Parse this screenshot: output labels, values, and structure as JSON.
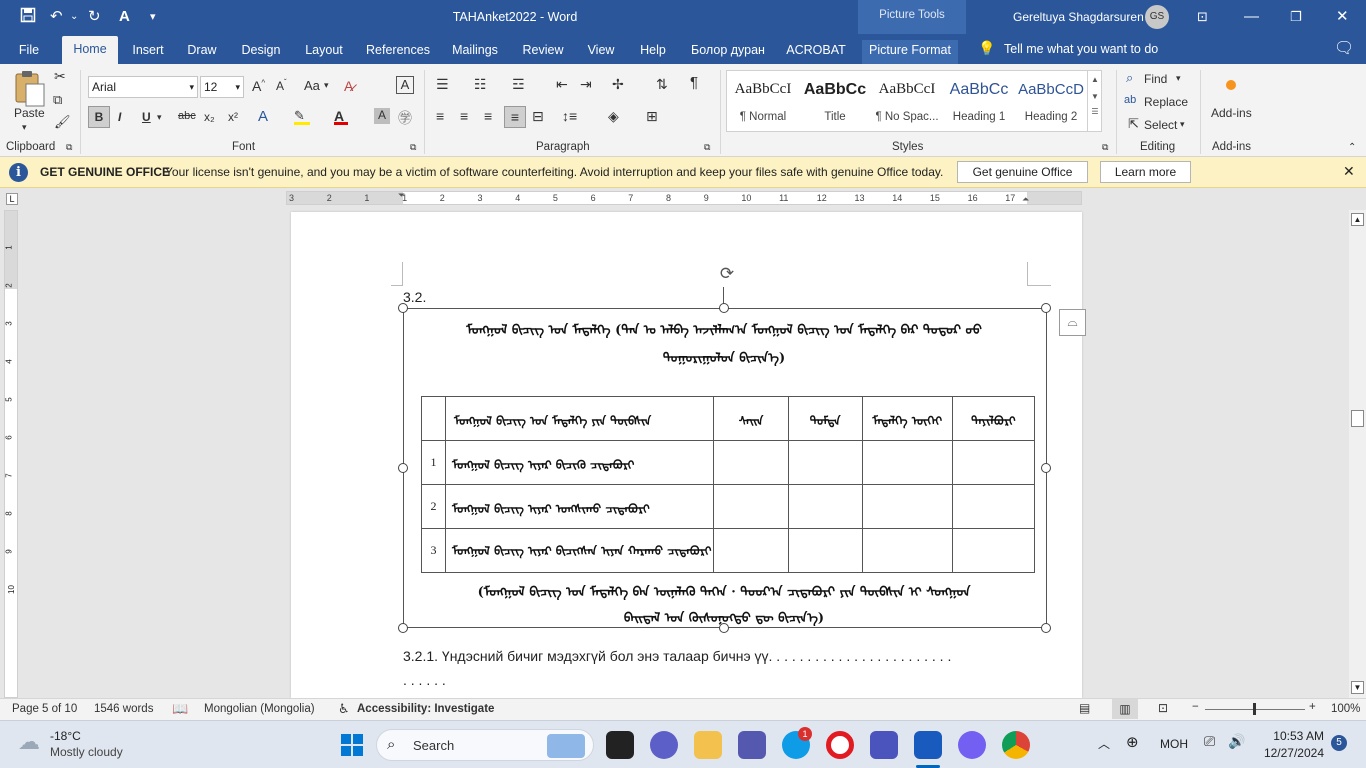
{
  "app": {
    "doc_title": "TAHAnket2022  -  Word",
    "context_tab_group": "Picture Tools",
    "user_name": "Gereltuya Shagdarsuren",
    "user_initials": "GS",
    "tell_me": "Tell me what you want to do"
  },
  "tabs": [
    "File",
    "Home",
    "Insert",
    "Draw",
    "Design",
    "Layout",
    "References",
    "Mailings",
    "Review",
    "View",
    "Help",
    "Болор дуран",
    "ACROBAT",
    "Picture Format"
  ],
  "ribbon": {
    "clipboard": {
      "paste": "Paste",
      "label": "Clipboard"
    },
    "font": {
      "name": "Arial",
      "size": "12",
      "label": "Font",
      "bold": "B",
      "italic": "I",
      "underline": "U",
      "strike": "abc",
      "sub": "x₂",
      "sup": "x²",
      "change_case": "Aa",
      "clear": "A"
    },
    "paragraph": {
      "label": "Paragraph"
    },
    "styles": {
      "label": "Styles",
      "items": [
        {
          "preview": "AaBbCcI",
          "name": "¶ Normal"
        },
        {
          "preview": "AaBbCc",
          "name": "Title"
        },
        {
          "preview": "AaBbCcI",
          "name": "¶ No Spac..."
        },
        {
          "preview": "AaBbCc",
          "name": "Heading 1"
        },
        {
          "preview": "AaBbCcD",
          "name": "Heading 2"
        }
      ]
    },
    "editing": {
      "label": "Editing",
      "find": "Find",
      "replace": "Replace",
      "select": "Select"
    },
    "addins": {
      "label": "Add-ins",
      "button": "Add-ins"
    }
  },
  "message_bar": {
    "title": "GET GENUINE OFFICE",
    "text": "Your license isn't genuine, and you may be a victim of software counterfeiting. Avoid interruption and keep your files safe with genuine Office today.",
    "button1": "Get genuine Office",
    "button2": "Learn more"
  },
  "ruler_numbers": [
    "3",
    "2",
    "1",
    "1",
    "2",
    "3",
    "4",
    "5",
    "6",
    "7",
    "8",
    "9",
    "10",
    "11",
    "12",
    "13",
    "14",
    "15",
    "16",
    "17"
  ],
  "vruler_numbers": [
    "1",
    "2",
    "3",
    "4",
    "5",
    "6",
    "7",
    "8",
    "9",
    "10"
  ],
  "document": {
    "section": "3.2.",
    "caption_line1": "ᠮᠣᠩᠭᠣᠯ ᠪᠢᠴᠢᠭ ᠤᠨ ᠮᠡᠳᠡᠯᠭᠡ (ᠲᠠᠨ ᠤ ᠠᠯᠪᠠ ᠠᠵᠢᠯᠯᠠᠭ᠎ᠠ ᠮᠣᠩᠭᠣᠯ ᠪᠢᠴᠢᠭ ᠤᠨ ᠮᠡᠳᠡᠯᠭᠡ ᠪᠡᠷ ᠲᠣᠳᠣᠷ ᠤᠤ",
    "caption_line2": "ᠲᠣᠭᠣᠷᠢᠭᠤᠯᠤᠨ ᠪᠢᠴᠢᠨ᠎ᠡ)",
    "table_header": [
      "",
      "ᠮᠣᠩᠭᠣᠯ ᠪᠢᠴᠢᠭ ᠤᠨ ᠮᠡᠳᠡᠯᠭᠡ ᠶᠢᠨ ᠲᠦᠪᠰᠢᠨ",
      "ᠰᠠᠢᠨ",
      "ᠳᠤᠮᠳᠠ",
      "ᠮᠡᠳᠡᠯᠭᠡ ᠦᠭᠡᠢ",
      "ᠲᠠᠶᠢᠯᠪᠤᠷᠢ"
    ],
    "table_rows": [
      {
        "num": "1",
        "text": "ᠮᠣᠩᠭᠣᠯ ᠪᠢᠴᠢᠭ ᠢᠶᠡᠷ ᠪᠢᠴᠢᠬᠦ ᠴᠢᠳᠠᠪᠤᠷᠢ"
      },
      {
        "num": "2",
        "text": "ᠮᠣᠩᠭᠣᠯ ᠪᠢᠴᠢᠭ ᠢᠶᠡᠷ ᠤᠩᠰᠢᠬᠤ ᠴᠢᠳᠠᠪᠤᠷᠢ"
      },
      {
        "num": "3",
        "text": "ᠮᠣᠩᠭᠣᠯ ᠪᠢᠴᠢᠭ ᠢᠶᠡᠷ ᠪᠢᠴᠢᠭᠰᠡᠨ ᠢᠶᠡᠨ ᠬᠠᠷᠠᠬᠤ ᠴᠢᠳᠠᠪᠤᠷᠢ"
      }
    ],
    "footer_line1": "(ᠮᠣᠩᠭᠣᠯ ᠪᠢᠴᠢᠭ ᠤᠨ ᠮᠡᠳᠡᠯᠭᠡ ᠪᠠᠨ ᠦᠨᠡᠯᠡᠬᠦ ᠳᠡᠭᠡᠨ · ᠳᠣᠣᠷ᠎ᠠ ᠴᠢᠳᠠᠪᠤᠷᠢ ᠶᠢᠨ ᠲᠦᠪᠰᠢᠨ ᠢ ᠰᠣᠩᠭᠣᠨ",
    "footer_line2": "ᠪᠠᠢᠳᠠᠯ ᠤᠨ ᠬᠦᠰᠦᠨᠦᠭᠲᠦ ᠳᠦ ᠪᠢᠴᠢᠨ᠎ᠡ)",
    "question": "3.2.1. Үндэсний бичиг мэдэхгүй бол энэ талаар бичнэ үү.  . . . . . . . . . . . . . . . . . . . . . . .",
    "question_cont": ". . . . . ."
  },
  "status": {
    "page": "Page 5 of 10",
    "words": "1546 words",
    "language": "Mongolian (Mongolia)",
    "accessibility": "Accessibility: Investigate",
    "zoom": "100%"
  },
  "taskbar": {
    "weather_temp": "-18°C",
    "weather_desc": "Mostly cloudy",
    "search": "Search",
    "lang": "МОН",
    "time": "10:53 AM",
    "date": "12/27/2024",
    "notif_count": "5",
    "skype_badge": "1"
  },
  "colors": {
    "word_blue": "#2b579a",
    "msg_bar": "#fdf2c3"
  }
}
